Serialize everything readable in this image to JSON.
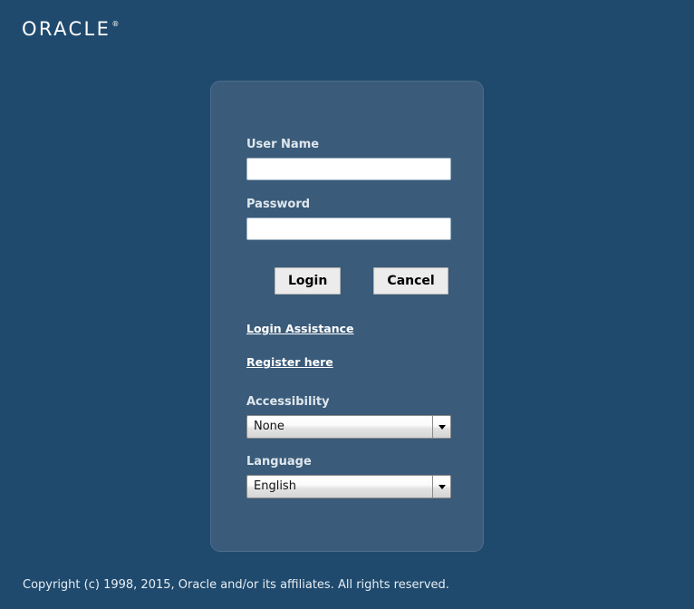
{
  "brand": {
    "name": "ORACLE",
    "trademark": "®"
  },
  "colors": {
    "page_background": "#1f4a6d",
    "panel_background": "#3a5b79",
    "panel_border": "#4c6d8a",
    "label_text": "#dfe7ee",
    "link_text": "#ffffff",
    "button_face": "#ececed",
    "input_background": "#ffffff",
    "footer_text": "#e8eef4"
  },
  "login_form": {
    "username": {
      "label": "User Name",
      "value": "",
      "placeholder": ""
    },
    "password": {
      "label": "Password",
      "value": "",
      "placeholder": ""
    },
    "buttons": {
      "login": "Login",
      "cancel": "Cancel"
    },
    "links": {
      "login_assistance": "Login Assistance",
      "register_here": "Register here"
    },
    "accessibility": {
      "label": "Accessibility",
      "selected": "None",
      "arrow_icon": "chevron-down-icon"
    },
    "language": {
      "label": "Language",
      "selected": "English",
      "arrow_icon": "chevron-down-icon"
    }
  },
  "footer": {
    "copyright": "Copyright (c) 1998, 2015, Oracle and/or its affiliates. All rights reserved."
  }
}
